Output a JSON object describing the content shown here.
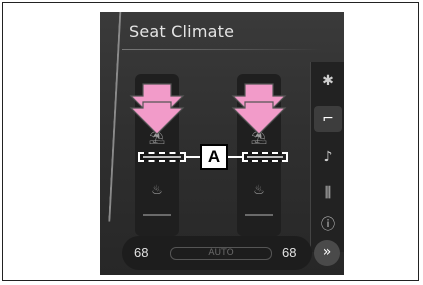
{
  "screen": {
    "title": "Seat Climate"
  },
  "callout": {
    "label": "A"
  },
  "seats": {
    "left": {
      "icon_top": "♨",
      "icon_mid": "⛱",
      "icon_bot": "♨"
    },
    "right": {
      "icon_top": "♨",
      "icon_mid": "⛱",
      "icon_bot": "♨"
    }
  },
  "side_menu": {
    "items": [
      {
        "name": "fan-icon",
        "glyph": "✱"
      },
      {
        "name": "seat-icon",
        "glyph": "⌐"
      },
      {
        "name": "music-icon",
        "glyph": "♪"
      },
      {
        "name": "equalizer-icon",
        "glyph": "⫼"
      },
      {
        "name": "info-icon",
        "glyph": "ⓘ"
      }
    ]
  },
  "bottom_bar": {
    "left_temp": "68",
    "right_temp": "68",
    "auto_label": "AUTO",
    "next_label": "»"
  },
  "colors": {
    "arrow": "#f29bc9",
    "arrow_outline": "#555555"
  }
}
